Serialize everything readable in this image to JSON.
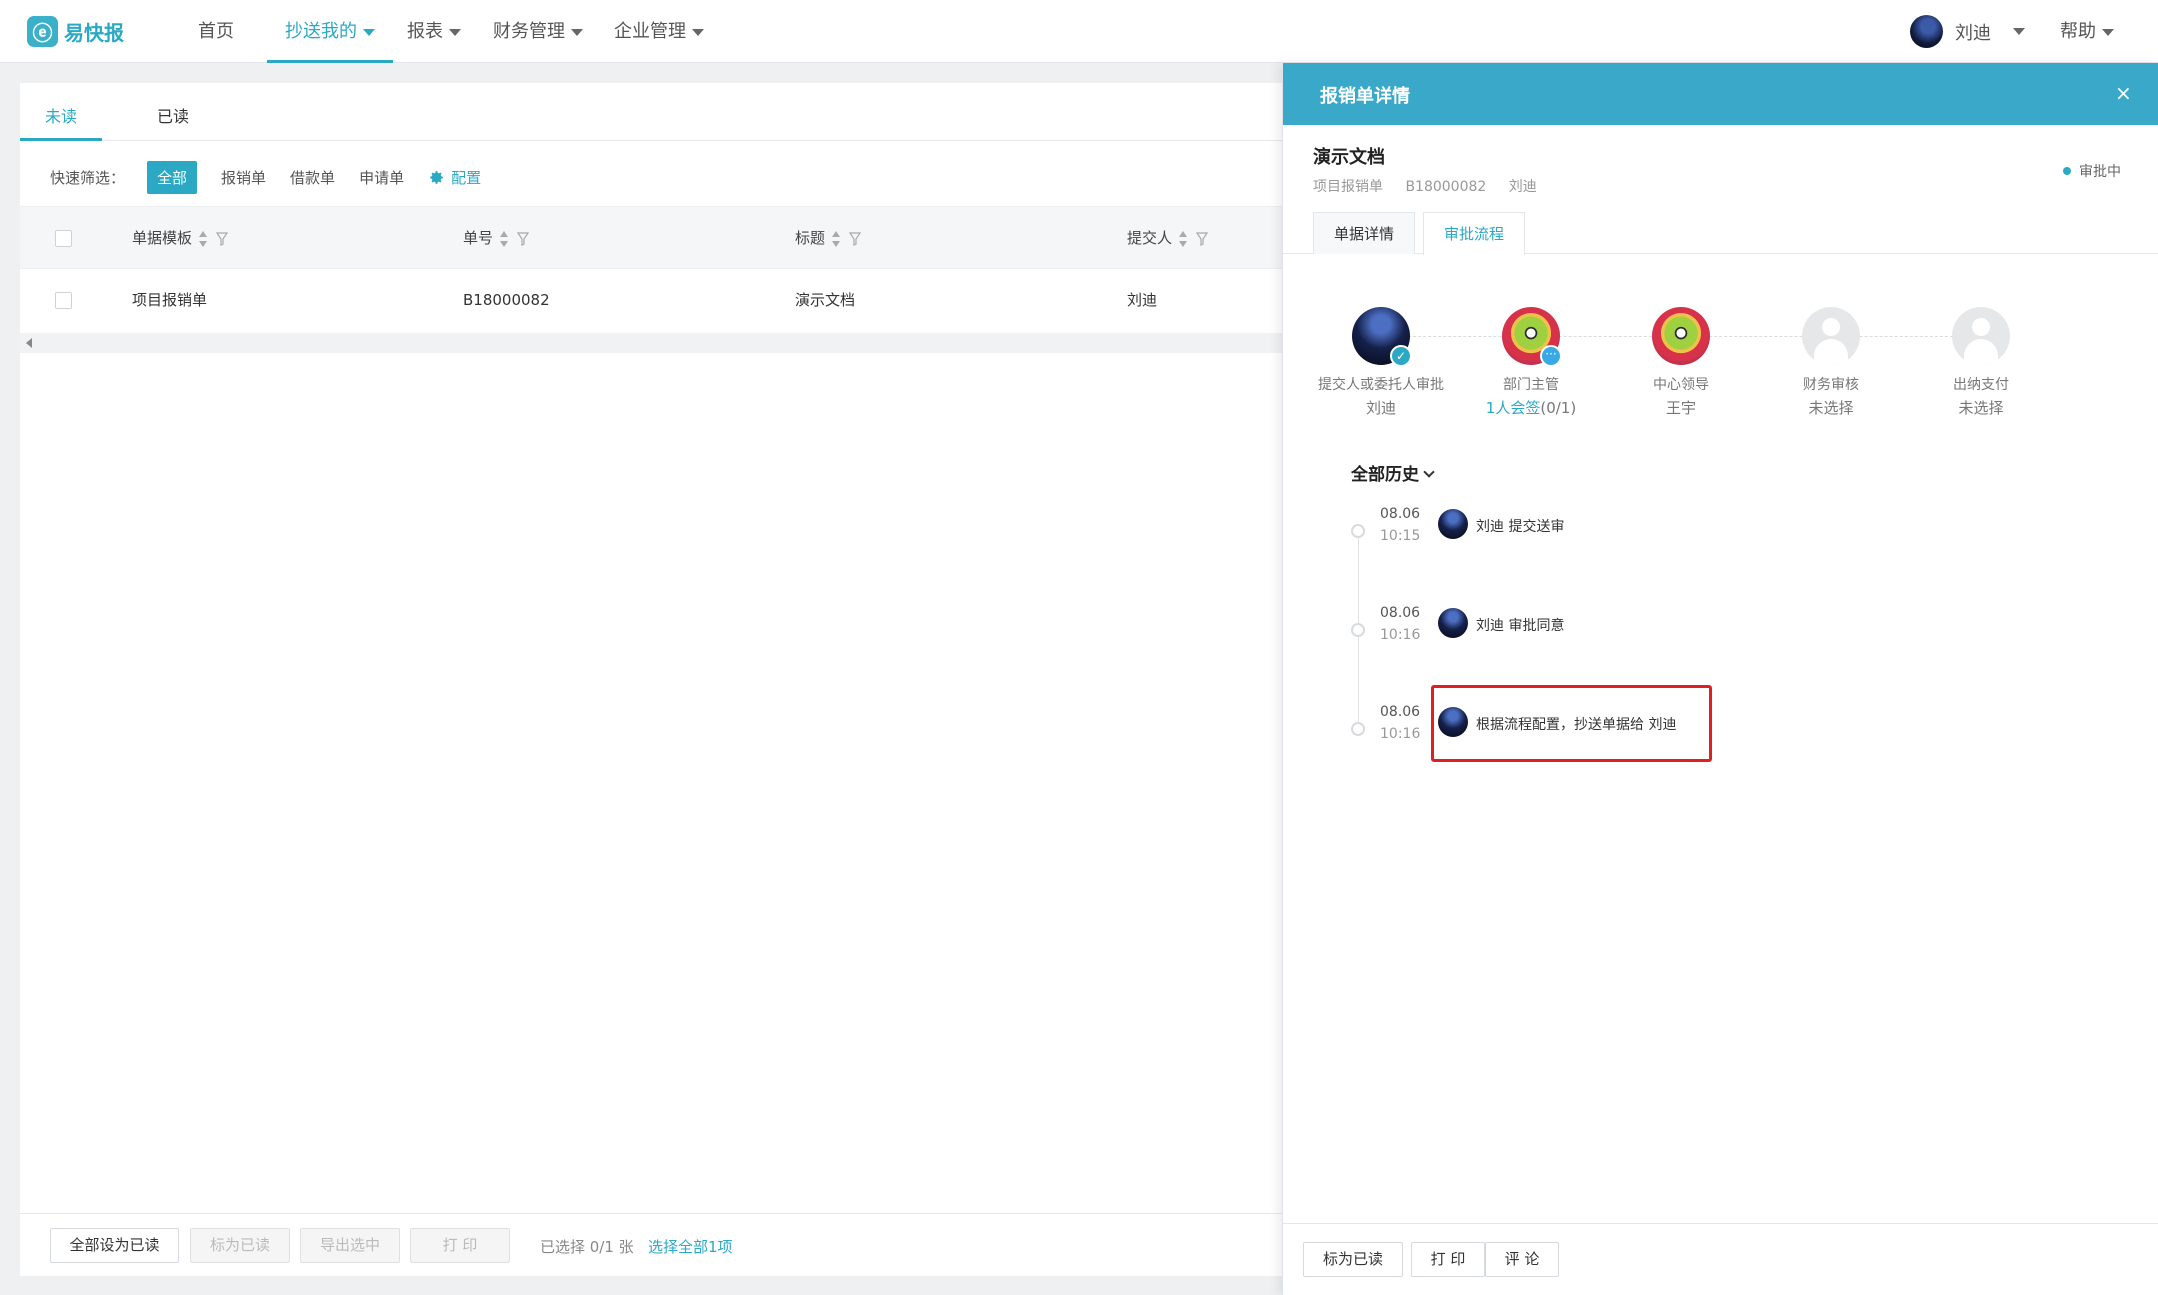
{
  "app": {
    "logo_mark": "ⓔ",
    "logo_text": "易快报"
  },
  "nav": {
    "items": [
      {
        "label": "首页"
      },
      {
        "label": "抄送我的"
      },
      {
        "label": "报表"
      },
      {
        "label": "财务管理"
      },
      {
        "label": "企业管理"
      }
    ],
    "user_name": "刘迪",
    "help_label": "帮助"
  },
  "list": {
    "tabs": [
      "未读",
      "已读"
    ],
    "quick_filter_label": "快速筛选：",
    "filters": [
      "全部",
      "报销单",
      "借款单",
      "申请单"
    ],
    "config_label": "配置",
    "columns": [
      "单据模板",
      "单号",
      "标题",
      "提交人"
    ],
    "rows": [
      {
        "template": "项目报销单",
        "number": "B18000082",
        "title": "演示文档",
        "submitter": "刘迪"
      }
    ],
    "footer": {
      "mark_all_read": "全部设为已读",
      "mark_read": "标为已读",
      "export_selected": "导出选中",
      "print": "打 印",
      "selected_text": "已选择 0/1 张",
      "select_all_link": "选择全部1项"
    }
  },
  "drawer": {
    "title": "报销单详情",
    "close": "×",
    "doc_title": "演示文档",
    "doc_type": "项目报销单",
    "doc_number": "B18000082",
    "doc_submitter": "刘迪",
    "status": "审批中",
    "tabs": [
      "单据详情",
      "审批流程"
    ],
    "flow_nodes": [
      {
        "role": "提交人或委托人审批",
        "who": "刘迪",
        "who_extra": ""
      },
      {
        "role": "部门主管",
        "who": "1人会签",
        "who_extra": "(0/1)"
      },
      {
        "role": "中心领导",
        "who": "王宇",
        "who_extra": ""
      },
      {
        "role": "财务审核",
        "who": "未选择",
        "who_extra": ""
      },
      {
        "role": "出纳支付",
        "who": "未选择",
        "who_extra": ""
      }
    ],
    "history_title": "全部历史",
    "history": [
      {
        "date": "08.06",
        "time": "10:15",
        "text": "刘迪 提交送审"
      },
      {
        "date": "08.06",
        "time": "10:16",
        "text": "刘迪 审批同意"
      },
      {
        "date": "08.06",
        "time": "10:16",
        "text": "根据流程配置，抄送单据给 刘迪"
      }
    ],
    "footer": {
      "mark_read": "标为已读",
      "print": "打 印",
      "comment": "评 论"
    }
  }
}
